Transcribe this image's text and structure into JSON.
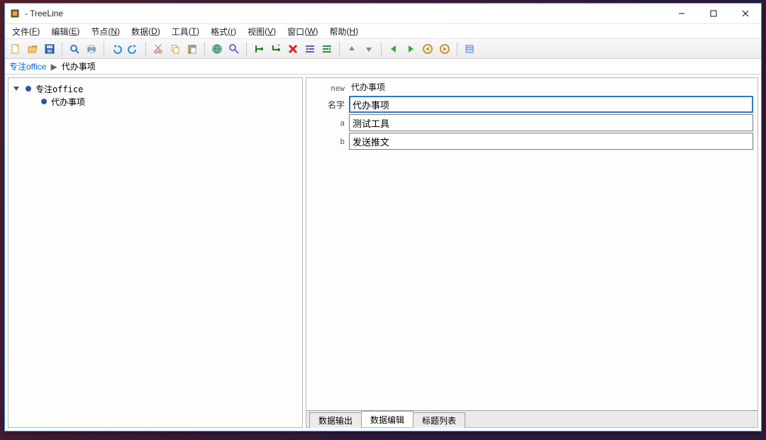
{
  "window": {
    "title": " - TreeLine"
  },
  "menu": {
    "file": {
      "label": "文件",
      "key": "F"
    },
    "edit": {
      "label": "编辑",
      "key": "E"
    },
    "node": {
      "label": "节点",
      "key": "N"
    },
    "data": {
      "label": "数据",
      "key": "D"
    },
    "tools": {
      "label": "工具",
      "key": "T"
    },
    "format": {
      "label": "格式",
      "key": "r"
    },
    "view": {
      "label": "视图",
      "key": "V"
    },
    "window": {
      "label": "窗口",
      "key": "W"
    },
    "help": {
      "label": "帮助",
      "key": "H"
    }
  },
  "breadcrumb": {
    "root": "专注office",
    "current": "代办事项"
  },
  "tree": {
    "root": {
      "label": "专注office"
    },
    "child": {
      "label": "代办事项"
    }
  },
  "editor": {
    "type_label": "new",
    "type_value": "代办事项",
    "fields": {
      "name": {
        "label": "名字",
        "value": "代办事项"
      },
      "a": {
        "label": "a",
        "value": "测试工具"
      },
      "b": {
        "label": "b",
        "value": "发送推文"
      }
    }
  },
  "tabs": {
    "output": "数据输出",
    "edit": "数据编辑",
    "titles": "标题列表"
  },
  "icons": {
    "new-file": "",
    "open": "",
    "save": "",
    "zoom": "",
    "print": "",
    "undo": "",
    "redo": "",
    "cut": "",
    "copy": "",
    "paste": "",
    "web": "",
    "find": "",
    "add-child": "",
    "add-sibling": "",
    "delete": "",
    "indent": "",
    "outdent": "",
    "move-up": "",
    "move-down": "",
    "play": "",
    "play-back": "",
    "history-back": "",
    "history-fwd": "",
    "config": ""
  }
}
